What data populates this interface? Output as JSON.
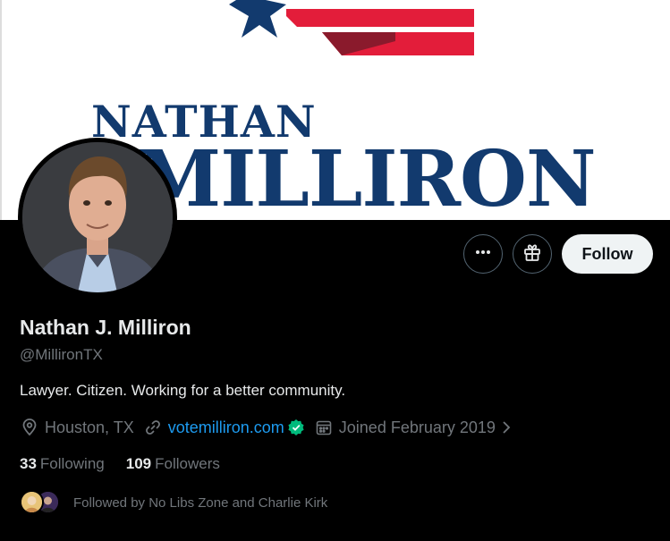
{
  "banner": {
    "first_name": "NATHAN",
    "last_name": "MILLIRON",
    "colors": {
      "navy": "#123a6e",
      "red": "#e31d3a"
    }
  },
  "profile": {
    "display_name": "Nathan J. Milliron",
    "handle": "@MillironTX",
    "bio": "Lawyer. Citizen. Working for a better community.",
    "location": "Houston, TX",
    "website": "votemilliron.com",
    "joined": "Joined February 2019"
  },
  "actions": {
    "more_icon": "more-horizontal-icon",
    "gift_icon": "gift-icon",
    "follow_label": "Follow"
  },
  "stats": {
    "following_count": "33",
    "following_label": "Following",
    "followers_count": "109",
    "followers_label": "Followers"
  },
  "followed_by": {
    "text": "Followed by No Libs Zone and Charlie Kirk"
  },
  "theme": {
    "background": "#000000",
    "accent": "#1d9bf0",
    "muted": "#71767b",
    "verified": "#00ba7c"
  }
}
